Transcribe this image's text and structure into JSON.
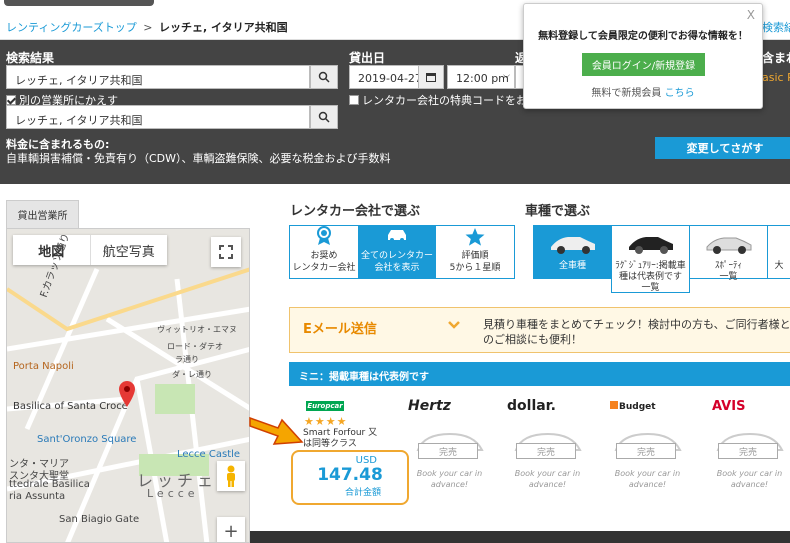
{
  "breadcrumb": {
    "home": "レンティングカーズトップ",
    "separator": ">",
    "current": "レッチェ, イタリア共和国"
  },
  "top_right_link": "検索結",
  "search": {
    "results_label": "検索結果",
    "pickup_value": "レッチェ, イタリア共和国",
    "other_office_label": "別の営業所にかえす",
    "other_office_checked": true,
    "return_value": "レッチェ, イタリア共和国",
    "date_label": "貸出日",
    "date_value": "2019-04-27",
    "time_value": "12:00 pm",
    "return_label_partial": "返",
    "included_label_partial": "含まれ",
    "promo_label": "レンタカー会社の特典コードをお持",
    "basic_partial": "asic Pr",
    "included_title": "料金に含まれるもの:",
    "included_text": "自車輌損害補償・免責有り（CDW）、車輌盗難保険、必要な税金および手数料",
    "change_button": "変更してさがす"
  },
  "popup": {
    "close": "X",
    "message": "無料登録して会員限定の便利でお得な情報を！",
    "login_button": "会員ログイン/新規登録",
    "register_text": "無料で新規会員",
    "register_link": "こちら"
  },
  "map": {
    "pickup_tab": "貸出営業所",
    "map_button": "地図",
    "satellite_button": "航空写真",
    "labels": {
      "street": "F.カラッソ通り",
      "napoli": "Porta Napoli",
      "basilica": "Basilica of Santa Croce",
      "oronzo": "Sant'Oronzo Square",
      "castle": "Lecce Castle",
      "duomo1": "ンタ・マリア",
      "duomo2": "スンタ大聖堂",
      "duomo3": "ttedrale Basilica",
      "duomo4": "ria Assunta",
      "city_jp": "レッチェ",
      "city_en": "Lecce",
      "gate": "San Biagio Gate",
      "st1": "ヴィットリオ・エマヌ",
      "st2": "ジュゼッペ・マッツィーニ",
      "st3": "レ通り",
      "st4": "ロード・ダテオ",
      "st5": "ラ通り",
      "st6": "ダ・レ通り",
      "st7": "ジーノ通り"
    }
  },
  "company_filter": {
    "title": "レンタカー会社で選ぶ",
    "tabs": [
      {
        "line1": "お奨め",
        "line2": "レンタカー会社",
        "active": false
      },
      {
        "line1": "全てのレンタカー",
        "line2": "会社を表示",
        "active": true
      },
      {
        "line1": "評価順",
        "line2": "5から１星順",
        "active": false
      }
    ]
  },
  "car_filter": {
    "title": "車種で選ぶ",
    "tabs": [
      {
        "line1": "全車種",
        "line2": "",
        "line3": "",
        "active": true
      },
      {
        "line1": "ﾗｸﾞｼﾞｭｱﾘｰ:掲載車",
        "line2": "種は代表例です",
        "line3": "一覧",
        "active": false
      },
      {
        "line1": "ｽﾎﾟｰﾃｨ",
        "line2": "一覧",
        "line3": "",
        "active": false
      },
      {
        "line1": "大",
        "line2": "",
        "line3": "",
        "active": false
      }
    ]
  },
  "email": {
    "title": "Eメール送信",
    "desc": "見積り車種をまとめてチェック！検討中の方も、ご同行者様とのご相談にも便利！"
  },
  "category_bar": "ミニ：掲載車種は代表例です",
  "vendors": [
    {
      "name": "Europcar"
    },
    {
      "name": "Hertz"
    },
    {
      "name": "dollar."
    },
    {
      "name": "Budget"
    },
    {
      "name": "AVIS"
    }
  ],
  "europcar_offer": {
    "stars": "★★★★",
    "rating": 4,
    "car": "Smart Forfour 又は同等クラス",
    "currency": "USD",
    "price": "147.48",
    "total_label": "合計金額"
  },
  "sold_out": {
    "label": "完売",
    "book": "Book your car in advance!"
  },
  "colors": {
    "accent": "#1a9ad6",
    "dark_bar": "#444444",
    "green": "#4cae4c",
    "orange": "#f0a830",
    "europcar_green": "#00a651",
    "hertz_yellow": "#ffd100",
    "dollar_red": "#d4002a",
    "avis_red": "#d4002a"
  }
}
